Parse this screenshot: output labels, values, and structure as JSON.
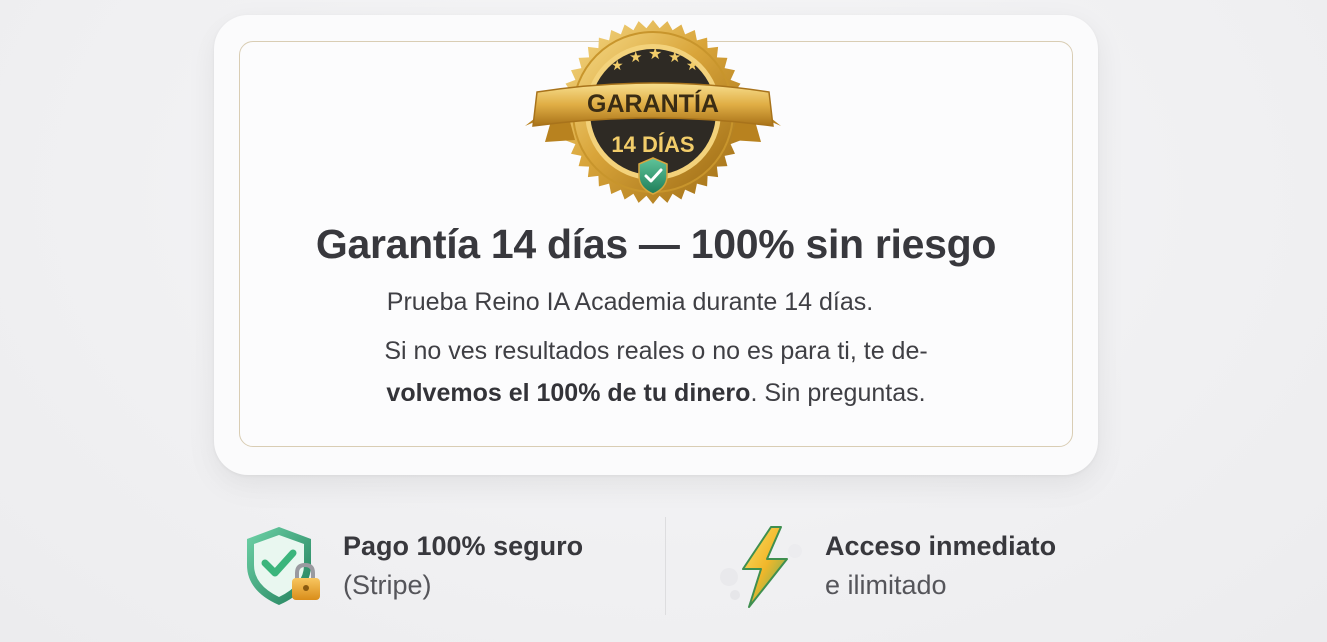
{
  "badge": {
    "top_text": "GARANTÍA",
    "bottom_text": "14 DÍAS"
  },
  "guarantee": {
    "title": "Garantía 14 días — 100% sin riesgo",
    "line1": "Prueba Reino IA Academia durante 14 días.",
    "line2": "Si no ves resultados reales o no es para ti, te de-",
    "line3_bold": "volvemos el 100% de tu dinero",
    "line3_rest": ". Sin preguntas."
  },
  "features": [
    {
      "title": "Pago 100% seguro",
      "subtitle": "(Stripe)",
      "icon": "shield-lock-icon"
    },
    {
      "title": "Acceso inmediato",
      "subtitle": "e ilimitado",
      "icon": "lightning-bolt-icon"
    }
  ],
  "colors": {
    "gold": "#c9962a",
    "badge_dark": "#2e2a24",
    "shield_green": "#2f9e74",
    "bolt_yellow": "#f4c430"
  }
}
